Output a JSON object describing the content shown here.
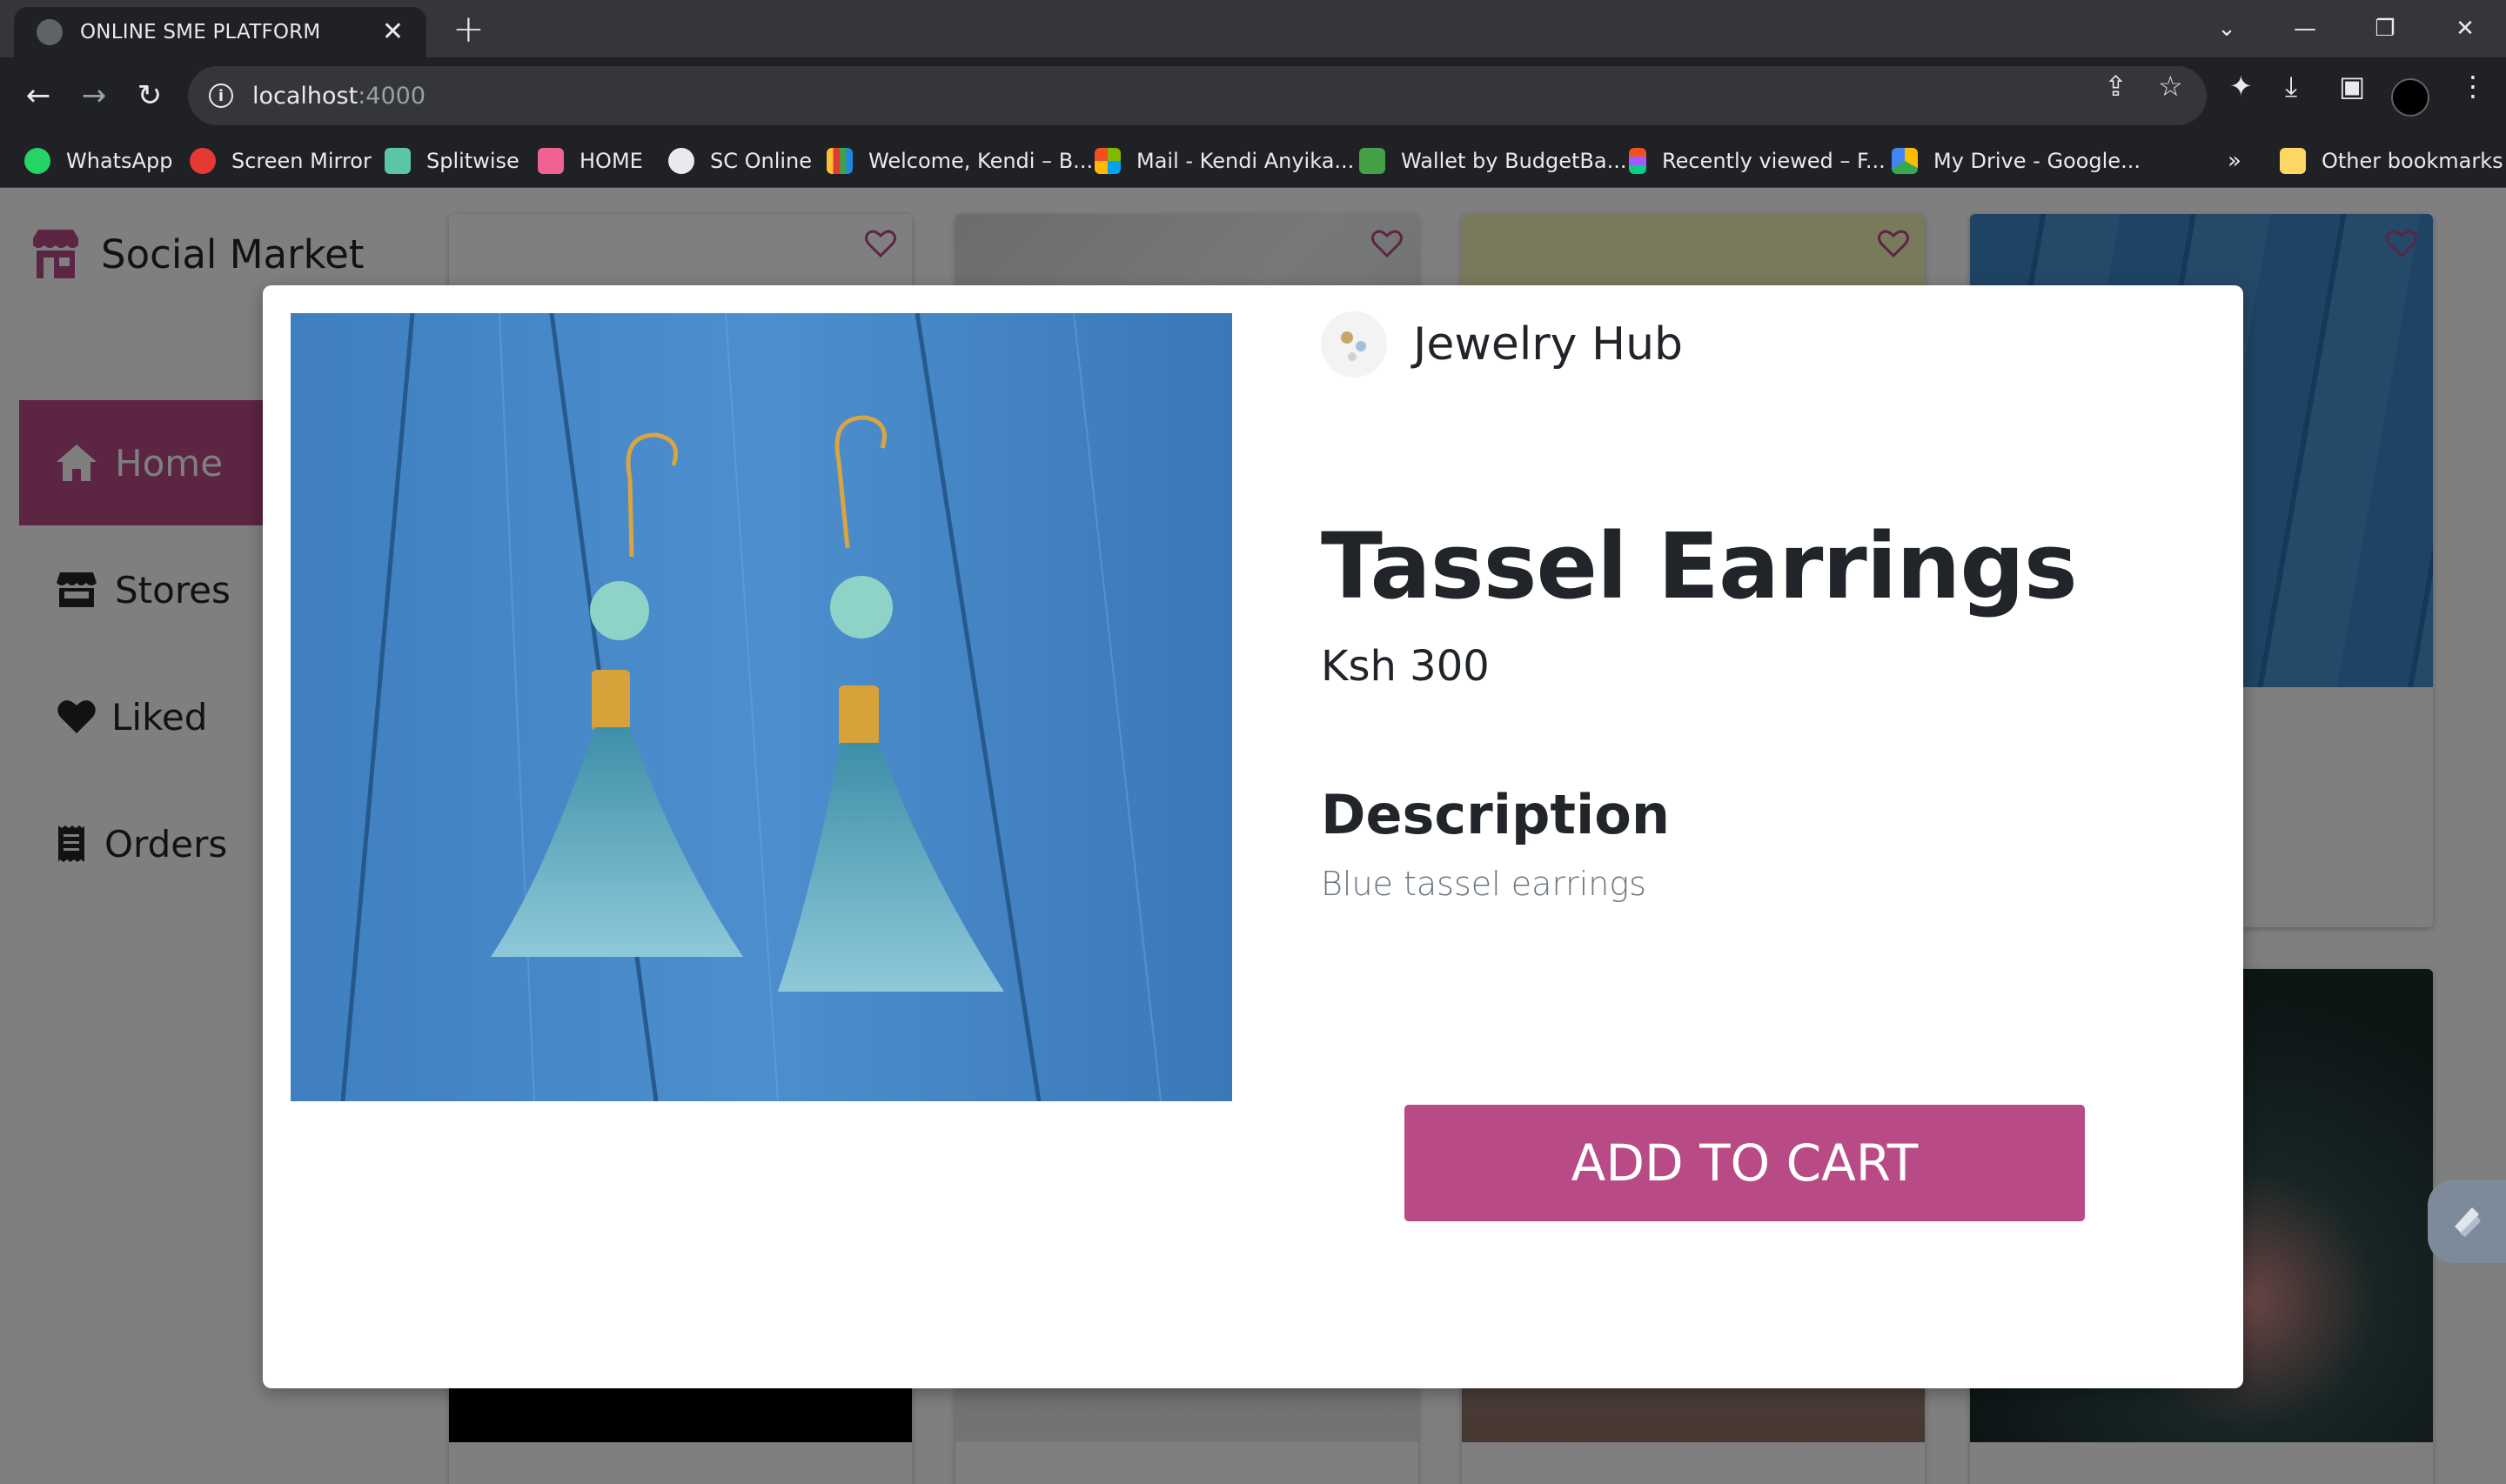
{
  "browser": {
    "tab_title": "ONLINE SME PLATFORM",
    "url_host": "localhost",
    "url_port": ":4000",
    "bookmarks": [
      {
        "label": "WhatsApp",
        "color": "#25d366"
      },
      {
        "label": "Screen Mirror",
        "color": "#e53935"
      },
      {
        "label": "Splitwise",
        "color": "#5bc5a7"
      },
      {
        "label": "HOME",
        "color": "#f06292"
      },
      {
        "label": "SC Online",
        "color": "#e8eaed"
      },
      {
        "label": "Welcome, Kendi – B...",
        "color": "#fbc02d"
      },
      {
        "label": "Mail - Kendi Anyika...",
        "color": "#0078d4"
      },
      {
        "label": "Wallet by BudgetBa...",
        "color": "#43a047"
      },
      {
        "label": "Recently viewed – F...",
        "color": "#a259ff"
      },
      {
        "label": "My Drive - Google...",
        "color": "#fbbc04"
      }
    ],
    "overflow_chevron": "»",
    "other_bookmarks": "Other bookmarks"
  },
  "sidebar": {
    "brand": "Social Market",
    "items": [
      {
        "label": "Home",
        "icon": "home-icon",
        "active": true
      },
      {
        "label": "Stores",
        "icon": "store-icon",
        "active": false
      },
      {
        "label": "Liked",
        "icon": "heart-icon",
        "active": false
      },
      {
        "label": "Orders",
        "icon": "receipt-icon",
        "active": false
      }
    ]
  },
  "modal": {
    "store_name": "Jewelry Hub",
    "product_title": "Tassel Earrings",
    "price": "Ksh 300",
    "description_heading": "Description",
    "description": "Blue tassel earrings",
    "add_to_cart": "ADD TO CART"
  },
  "colors": {
    "accent": "#b84a86",
    "chrome_dark": "#202124",
    "chrome_tab": "#35363a"
  }
}
